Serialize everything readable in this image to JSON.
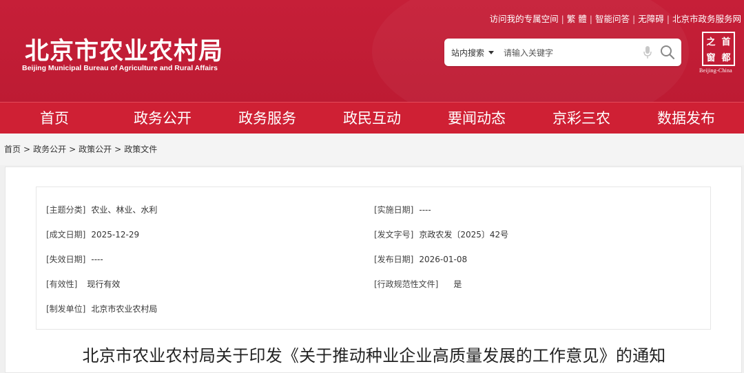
{
  "header": {
    "top_links": [
      "访问我的专属空间",
      "繁 體",
      "智能问答",
      "无障碍",
      "北京市政务服务网"
    ],
    "site_title": "北京市农业农村局",
    "site_subtitle": "Beijing Municipal Bureau of Agriculture and Rural Affairs",
    "search": {
      "scope_label": "站内搜索",
      "placeholder": "请输入关键字"
    },
    "emblem": {
      "chars": [
        "之",
        "首",
        "窗",
        "都"
      ],
      "caption": "Beijing-China"
    }
  },
  "nav": {
    "items": [
      "首页",
      "政务公开",
      "政务服务",
      "政民互动",
      "要闻动态",
      "京彩三农",
      "数据发布"
    ]
  },
  "breadcrumb": [
    "首页",
    "政务公开",
    "政策公开",
    "政策文件"
  ],
  "meta": {
    "topic": {
      "label": "[主题分类]",
      "value": "农业、林业、水利"
    },
    "effective_date": {
      "label": "[实施日期]",
      "value": "----"
    },
    "written_date": {
      "label": "[成文日期]",
      "value": "2025-12-29"
    },
    "doc_number": {
      "label": "[发文字号]",
      "value": "京政农发〔2025〕42号"
    },
    "expiry_date": {
      "label": "[失效日期]",
      "value": "----"
    },
    "publish_date": {
      "label": "[发布日期]",
      "value": "2026-01-08"
    },
    "validity": {
      "label": "[有效性]",
      "value": "现行有效"
    },
    "normative": {
      "label": "[行政规范性文件]",
      "value": "是"
    },
    "issuer": {
      "label": "[制发单位]",
      "value": "北京市农业农村局"
    }
  },
  "document": {
    "title": "北京市农业农村局关于印发《关于推动种业企业高质量发展的工作意见》的通知"
  },
  "colors": {
    "brand_red": "#c21f36",
    "nav_red": "#cf2034"
  }
}
